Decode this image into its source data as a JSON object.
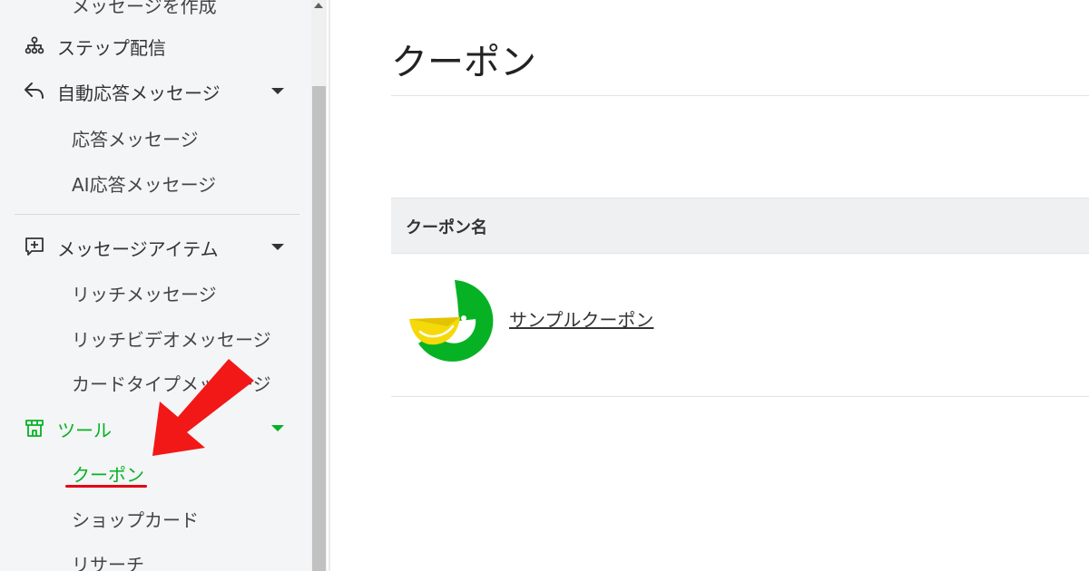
{
  "sidebar": {
    "items": {
      "compose_message": {
        "label": "メッセージを作成"
      },
      "step_delivery": {
        "label": "ステップ配信",
        "icon": "hierarchy-icon"
      },
      "auto_reply": {
        "label": "自動応答メッセージ",
        "icon": "reply-icon"
      },
      "reply_message": {
        "label": "応答メッセージ"
      },
      "ai_reply_message": {
        "label": "AI応答メッセージ"
      },
      "message_items": {
        "label": "メッセージアイテム",
        "icon": "message-plus-icon"
      },
      "rich_message": {
        "label": "リッチメッセージ"
      },
      "rich_video_message": {
        "label": "リッチビデオメッセージ"
      },
      "card_type_message": {
        "label": "カードタイプメッセージ"
      },
      "tools": {
        "label": "ツール",
        "icon": "store-icon"
      },
      "coupon": {
        "label": "クーポン"
      },
      "shop_card": {
        "label": "ショップカード"
      },
      "research": {
        "label": "リサーチ"
      }
    }
  },
  "main": {
    "title": "クーポン",
    "table": {
      "column_header": "クーポン名",
      "rows": [
        {
          "name": "サンプルクーポン",
          "thumbnail": "coupon-thumbnail"
        }
      ]
    }
  },
  "colors": {
    "active_green": "#06b224",
    "annotation_red": "#e60012",
    "sidebar_bg": "#f4f5f6",
    "header_bg": "#eff0f1"
  }
}
